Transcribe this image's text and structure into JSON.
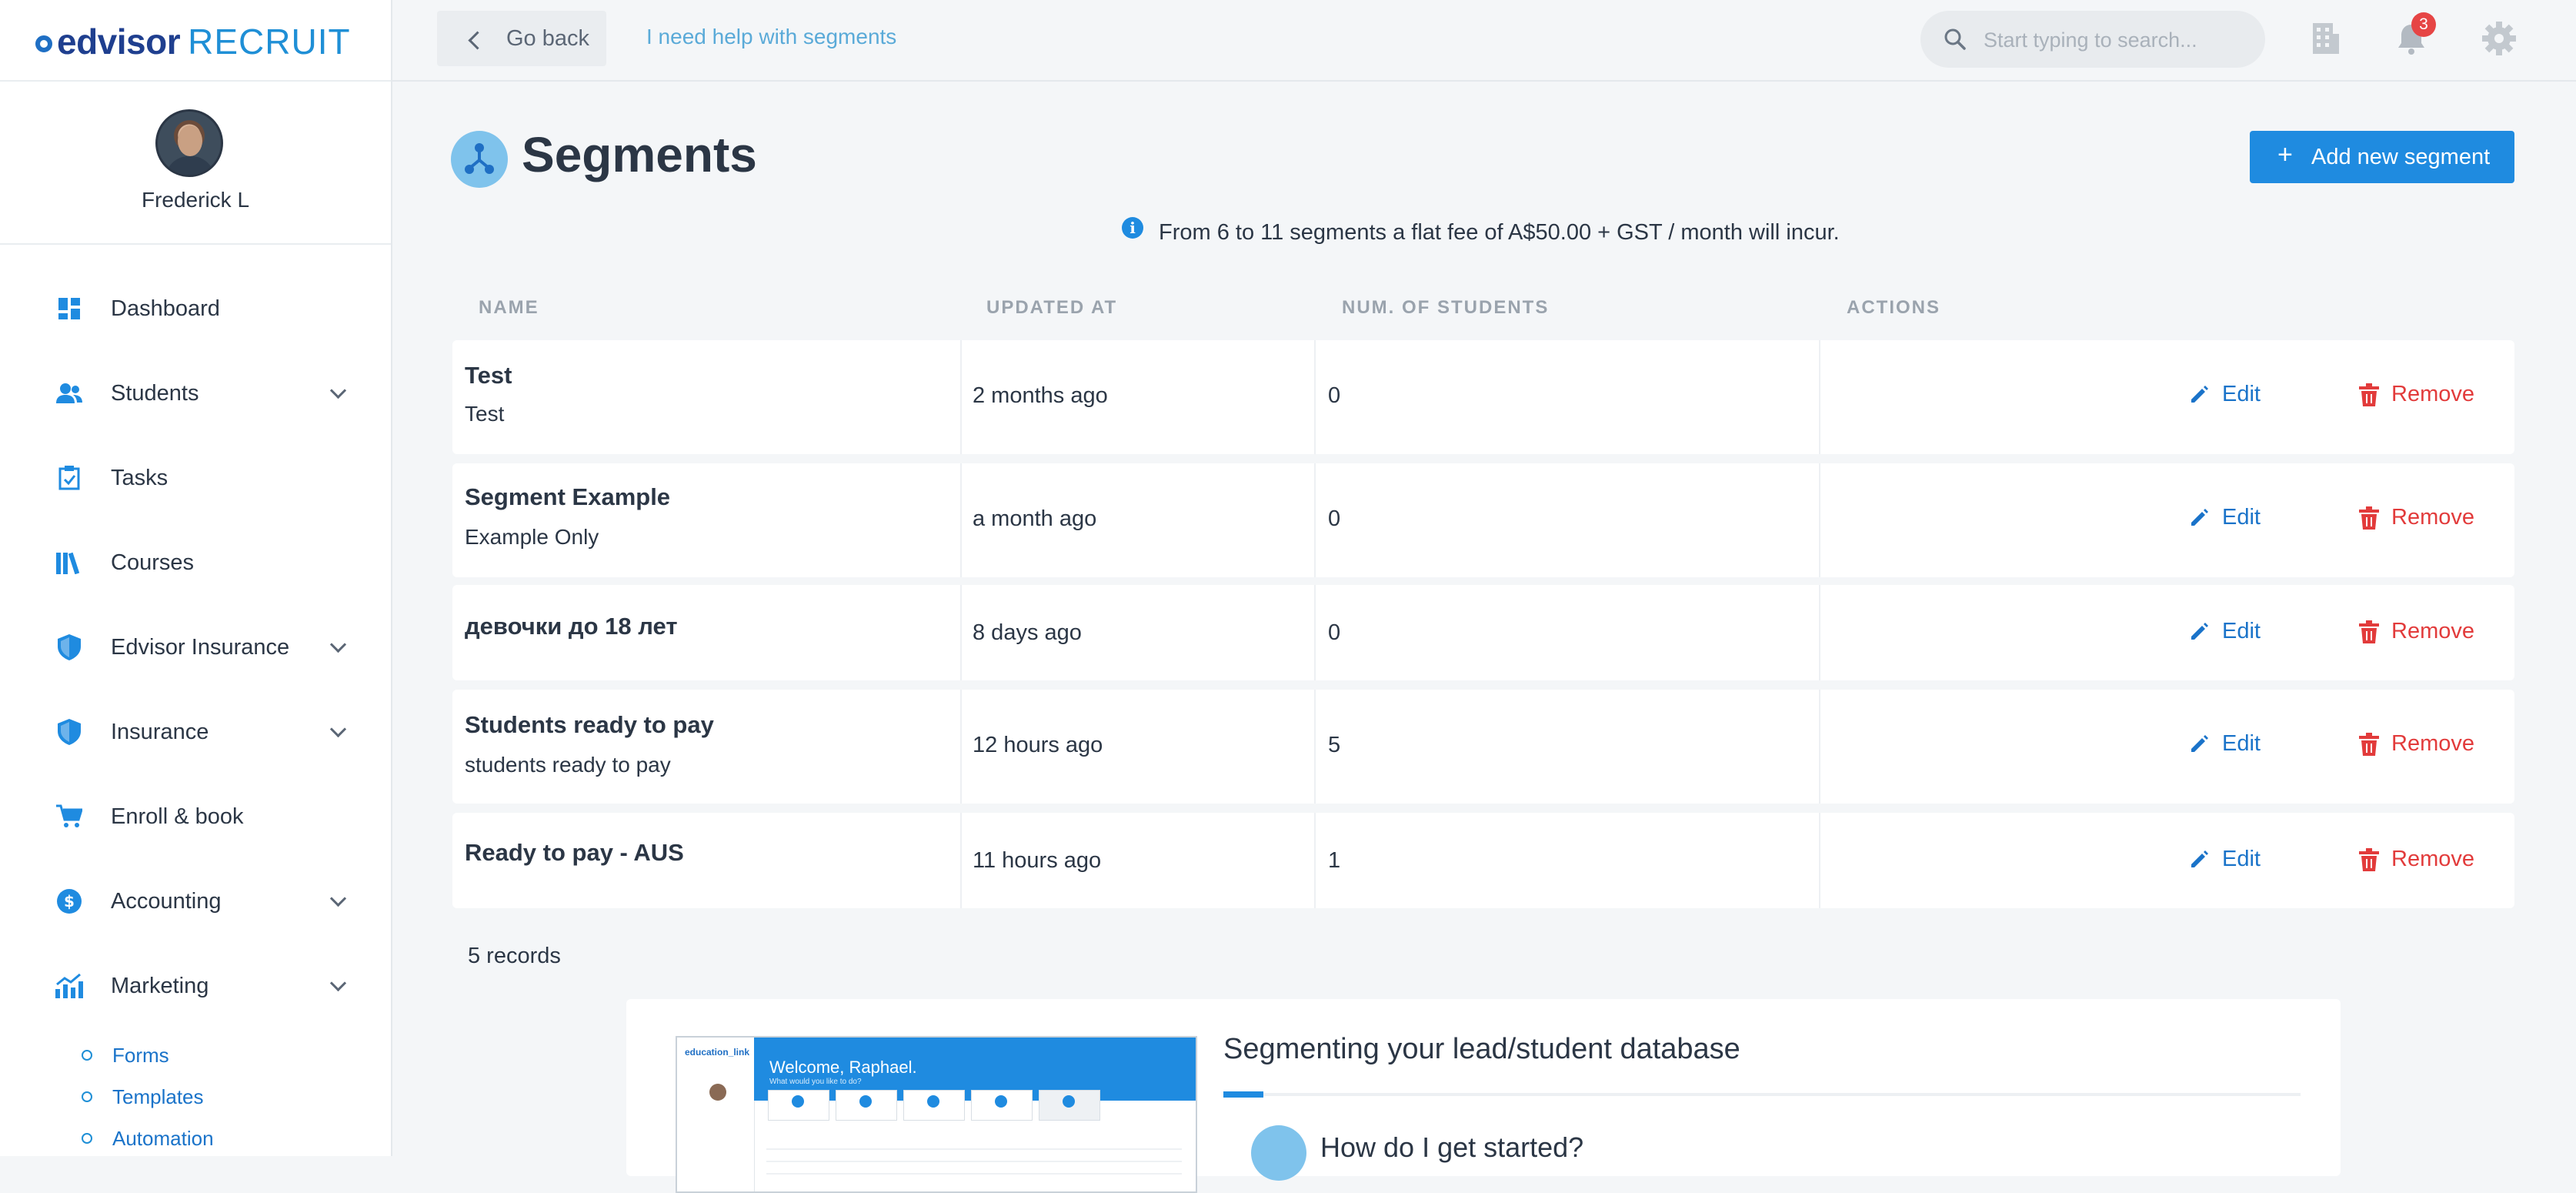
{
  "app": {
    "logo_brand": "edvisor",
    "logo_product": "RECRUIT"
  },
  "user": {
    "name": "Frederick L"
  },
  "sidebar": {
    "items": [
      {
        "label": "Dashboard",
        "icon": "dashboard-icon",
        "expandable": false
      },
      {
        "label": "Students",
        "icon": "students-icon",
        "expandable": true
      },
      {
        "label": "Tasks",
        "icon": "tasks-icon",
        "expandable": false
      },
      {
        "label": "Courses",
        "icon": "courses-icon",
        "expandable": false
      },
      {
        "label": "Edvisor Insurance",
        "icon": "shield-icon",
        "expandable": true
      },
      {
        "label": "Insurance",
        "icon": "shield-icon",
        "expandable": true
      },
      {
        "label": "Enroll & book",
        "icon": "cart-icon",
        "expandable": false
      },
      {
        "label": "Accounting",
        "icon": "dollar-icon",
        "expandable": true
      },
      {
        "label": "Marketing",
        "icon": "chart-icon",
        "expandable": true
      }
    ],
    "marketing_subitems": [
      {
        "label": "Forms"
      },
      {
        "label": "Templates"
      },
      {
        "label": "Automation"
      }
    ]
  },
  "topbar": {
    "go_back_label": "Go back",
    "help_link": "I need help with segments",
    "search_placeholder": "Start typing to search...",
    "notification_count": "3"
  },
  "page": {
    "title": "Segments",
    "add_button_label": "Add new segment",
    "notice": "From 6 to 11 segments a flat fee of A$50.00 + GST / month will incur."
  },
  "table": {
    "columns": [
      "NAME",
      "UPDATED AT",
      "NUM. OF STUDENTS",
      "ACTIONS"
    ],
    "edit_label": "Edit",
    "remove_label": "Remove",
    "rows": [
      {
        "name": "Test",
        "description": "Test",
        "updated_at": "2 months ago",
        "num_students": "0"
      },
      {
        "name": "Segment Example",
        "description": "Example Only",
        "updated_at": "a month ago",
        "num_students": "0"
      },
      {
        "name": "девочки до 18 лет",
        "description": "",
        "updated_at": "8 days ago",
        "num_students": "0"
      },
      {
        "name": "Students ready to pay",
        "description": "students ready to pay",
        "updated_at": "12 hours ago",
        "num_students": "5"
      },
      {
        "name": "Ready to pay - AUS",
        "description": "",
        "updated_at": "11 hours ago",
        "num_students": "1"
      }
    ],
    "records_label": "5 records"
  },
  "help_card": {
    "title": "Segmenting your lead/student database",
    "question": "How do I get started?",
    "thumbnail_logo": "education_link",
    "thumbnail_welcome": "Welcome, Raphael.",
    "thumbnail_subtitle": "What would you like to do?"
  },
  "colors": {
    "accent": "#1f8be0",
    "link": "#1a73c9",
    "danger": "#e23b3b",
    "badge": "#e64545"
  }
}
